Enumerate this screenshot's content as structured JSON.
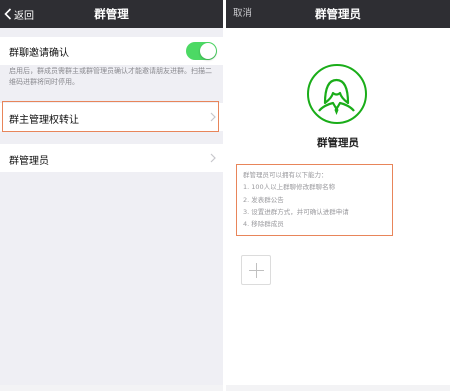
{
  "left": {
    "nav": {
      "back_label": "返回",
      "title": "群管理"
    },
    "invite_confirm": {
      "label": "群聊邀请确认",
      "enabled": true,
      "description": "启用后，群成员需群主或群管理员确认才能邀请朋友进群。扫描二维码进群将同时停用。"
    },
    "transfer_owner": {
      "label": "群主管理权转让"
    },
    "admins": {
      "label": "群管理员"
    }
  },
  "right": {
    "nav": {
      "cancel_label": "取消",
      "title": "群管理员"
    },
    "role_title": "群管理员",
    "abilities": {
      "intro": "群管理员可以拥有以下能力：",
      "items": [
        "1. 100人以上群聊修改群聊名称",
        "2. 发表群公告",
        "3. 设置进群方式，并可确认进群申请",
        "4. 移除群成员"
      ]
    },
    "add_icon": "plus-icon"
  },
  "colors": {
    "nav_bg": "#2e2e33",
    "toggle_on": "#4cd964",
    "highlight": "#e8855a",
    "wechat_green": "#1aad19"
  }
}
